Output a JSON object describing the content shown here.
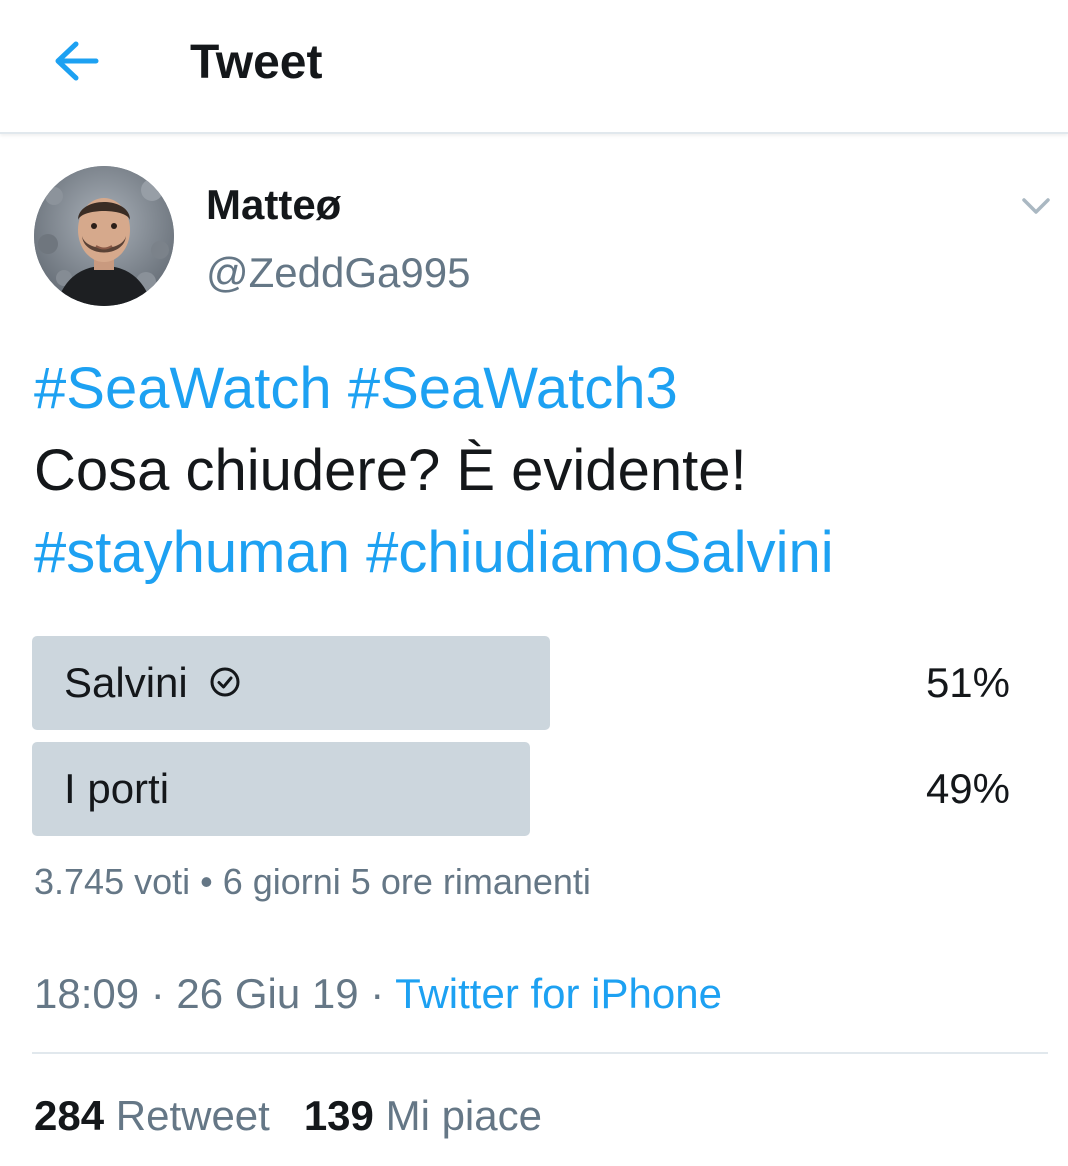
{
  "header": {
    "title": "Tweet",
    "back_icon": "arrow-left-icon",
    "accent_color": "#1da1f2"
  },
  "author": {
    "display_name": "Matteø",
    "handle": "@ZeddGa995",
    "menu_icon": "chevron-down-icon"
  },
  "tweet": {
    "line1": {
      "hashtag1": "#SeaWatch",
      "hashtag2": "#SeaWatch3"
    },
    "line2": "Cosa chiudere? È evidente!",
    "line3": {
      "hashtag1": "#stayhuman",
      "hashtag2": "#chiudiamoSalvini"
    }
  },
  "poll": {
    "options": [
      {
        "label": "Salvini",
        "percent_text": "51%",
        "percent": 51,
        "winner": true,
        "icon": "check-circle-icon"
      },
      {
        "label": "I porti",
        "percent_text": "49%",
        "percent": 49,
        "winner": false
      }
    ],
    "meta": "3.745 voti • 6 giorni 5 ore rimanenti",
    "bar_color": "#ccd6dd"
  },
  "timestamp": {
    "time_date": "18:09 · 26 Giu 19 · ",
    "source": "Twitter for iPhone"
  },
  "stats": {
    "retweets_count": "284",
    "retweets_label": "Retweet",
    "likes_count": "139",
    "likes_label": "Mi piace"
  }
}
